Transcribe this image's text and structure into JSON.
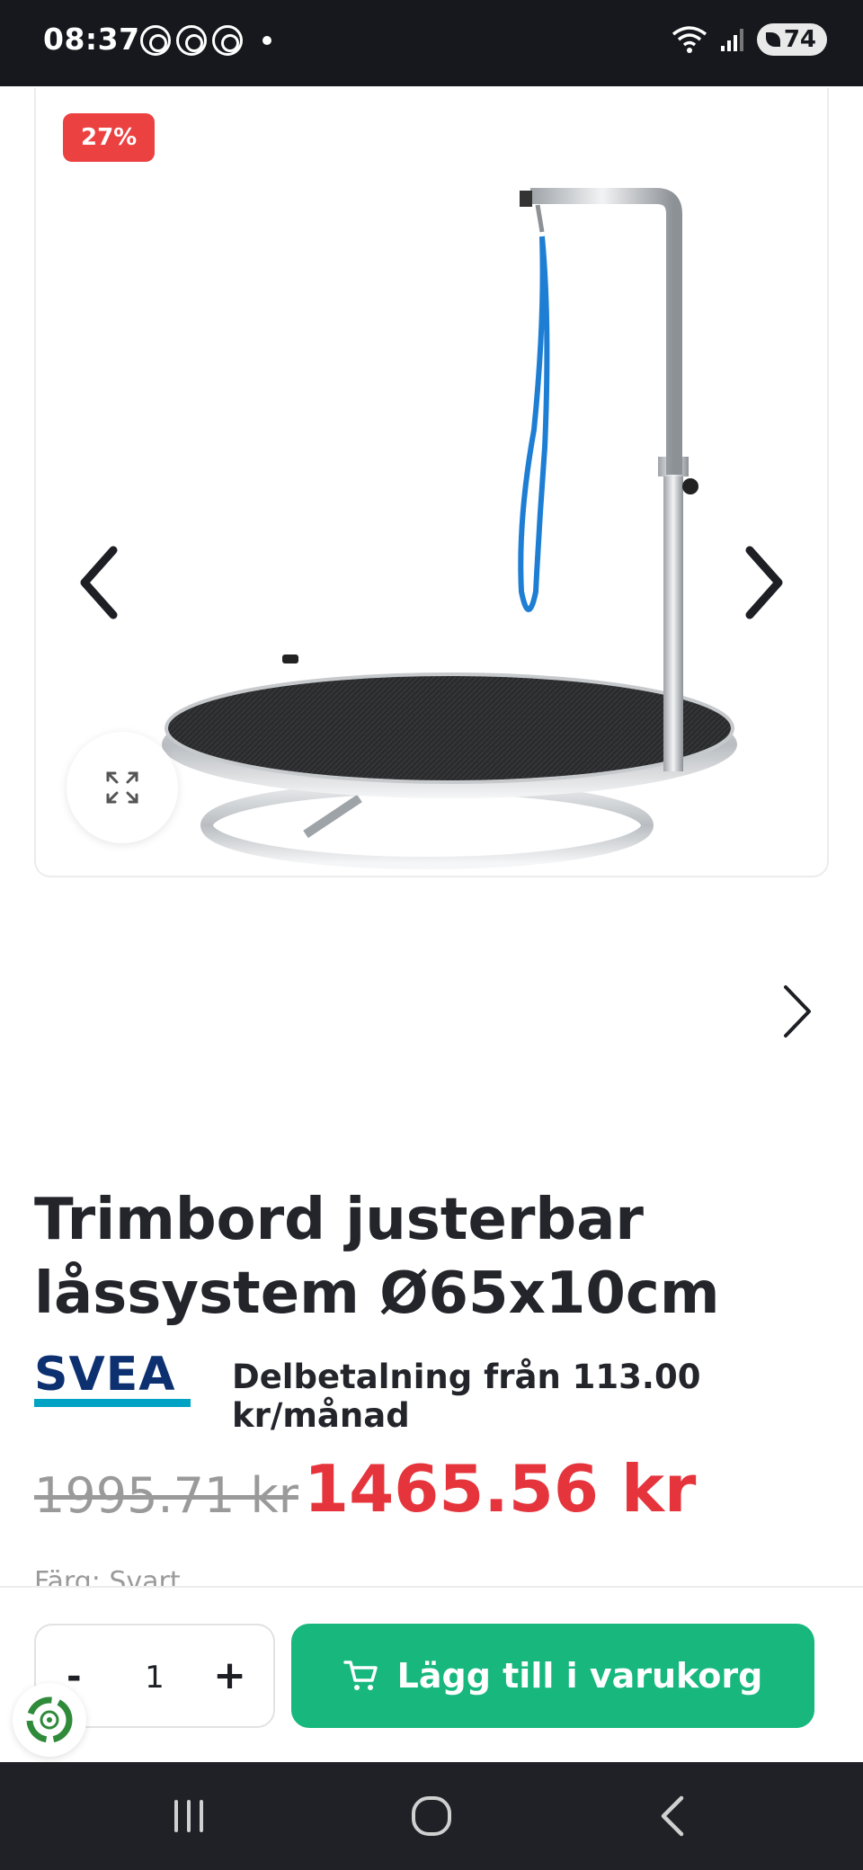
{
  "status_bar": {
    "time": "08:37",
    "battery": "74",
    "icons": [
      "threads-notification-icon",
      "threads-notification-icon",
      "threads-notification-icon",
      "dot-icon",
      "wifi-icon",
      "signal-icon",
      "battery-icon"
    ]
  },
  "gallery": {
    "discount_badge": "27%",
    "prev_icon": "chevron-left-icon",
    "next_icon": "chevron-right-icon",
    "expand_icon": "expand-icon"
  },
  "product": {
    "title_line1": "Trimbord justerbar",
    "title_line2": "låssystem Ø65x10cm",
    "installment_text": "Delbetalning från 113.00 kr/månad",
    "old_price": "1995.71 kr",
    "new_price": "1465.56 kr",
    "color_label": "Färg: Svart",
    "brand_logo_text": "SVEA"
  },
  "action_bar": {
    "qty_minus": "-",
    "qty_value": "1",
    "qty_plus": "+",
    "add_to_cart_label": "Lägg till i varukorg",
    "cart_icon": "cart-icon"
  },
  "colors": {
    "accent_green": "#17b77e",
    "sale_red": "#e5343c",
    "badge_red": "#ec4141",
    "svea_blue": "#0d3170",
    "svea_teal": "#00a3c4"
  }
}
